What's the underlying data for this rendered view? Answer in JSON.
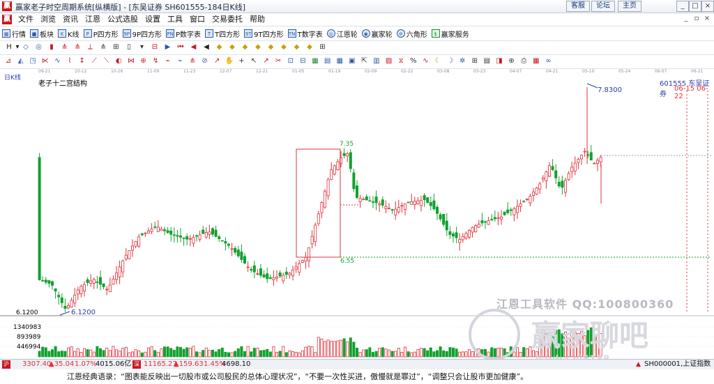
{
  "window": {
    "logo": "赢",
    "title": "赢家老子时空周期系统[纵横版] - [东吴证券  SH601555-184日K线]",
    "links": [
      "客服",
      "论坛",
      "主页"
    ]
  },
  "menu": {
    "items": [
      "文件",
      "浏览",
      "资讯",
      "江恩",
      "公式选股",
      "设置",
      "工具",
      "窗口",
      "交易委托",
      "帮助"
    ]
  },
  "toolbar1": {
    "items": [
      {
        "icon": "grid",
        "label": "行情"
      },
      {
        "icon": "block",
        "label": "板块"
      },
      {
        "icon": "k",
        "label": "K线"
      },
      {
        "icon": "P",
        "label": "P四方形"
      },
      {
        "icon": "9P",
        "label": "9P四方形"
      },
      {
        "icon": "PN",
        "label": "P数字表"
      },
      {
        "icon": "T",
        "label": "T四方形"
      },
      {
        "icon": "9T",
        "label": "9T四方形"
      },
      {
        "icon": "TN",
        "label": "T数字表"
      },
      {
        "icon": "wheel",
        "label": "江恩轮"
      },
      {
        "icon": "wheel2",
        "label": "赢家轮"
      },
      {
        "icon": "star",
        "label": "六角形"
      },
      {
        "icon": "dollar",
        "label": "赢家服务"
      }
    ]
  },
  "chart_labels": {
    "period": "日K线",
    "indicator": "老子十二宫结构",
    "code_name": "601555  东吴证券",
    "date_range": "06-15 06-22",
    "low_price": "6.1200",
    "low_label": "6.1200",
    "high_price": "7.8300",
    "box_top": "7.35",
    "box_bottom": "6.55",
    "vol1": "1340983",
    "vol2": "893989",
    "vol3": "446994",
    "watermark_text": "江恩工具软件  QQ:100800360",
    "watermark_big": "赢家聊吧",
    "watermark_url": "liaoba.yj5188"
  },
  "axis_dates": [
    "09-21",
    "10-12",
    "10-26",
    "11-09",
    "11-23",
    "12-07",
    "12-21",
    "01-05",
    "01-19",
    "02-09",
    "02-22",
    "03-08",
    "03-23",
    "04-07",
    "04-21",
    "05-10",
    "05-24",
    "06-07",
    "06-21"
  ],
  "status": {
    "sh_index": "3307.40",
    "sh_change": "▲35.04",
    "sh_pct": "1.07%",
    "sh_amount": "4015.06亿",
    "sz_index": "11165.27",
    "sz_change": "▲159.63",
    "sz_pct": "1.45%",
    "sz_amount": "4698.10",
    "right": "SH000001,上证指数"
  },
  "quote": "江恩经典语录：“图表能反映出一切股市或公司股民的总体心理状况”，“不要一次性买进，傲慢就是罪过”，“调整只会让股市更加健康”。",
  "colors": {
    "up": "#e0303a",
    "down": "#12a12f",
    "axis_label": "#2a3bb0",
    "dotted": "#12a12f"
  }
}
